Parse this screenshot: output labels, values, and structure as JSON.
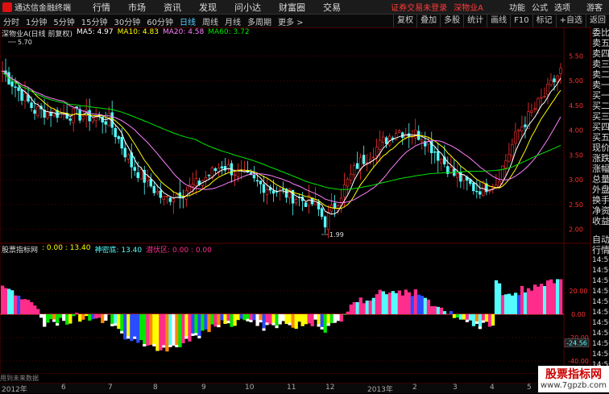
{
  "app": {
    "name": "通达信金融终端",
    "menu": [
      "行情",
      "市场",
      "资讯",
      "发现",
      "问小达",
      "财富圈",
      "交易"
    ],
    "login_warning": "证券交易未登录",
    "stock_title": "深物业A",
    "right_menu": [
      "功能",
      "公式",
      "选项",
      "游客"
    ]
  },
  "tabs": [
    "分时",
    "1分钟",
    "5分钟",
    "15分钟",
    "30分钟",
    "60分钟",
    "日线",
    "周线",
    "月线",
    "多周期",
    "更多 >"
  ],
  "active_tab": "日线",
  "toolbar_right": [
    "复权",
    "叠加",
    "多股",
    "统计",
    "画线",
    "F10",
    "标记",
    "+自选",
    "返回"
  ],
  "main_legend": {
    "title": "深物业A(日线 前复权)",
    "ma5": "MA5: 4.97",
    "ma10": "MA10: 4.83",
    "ma20": "MA20: 4.58",
    "ma60": "MA60: 3.72"
  },
  "price_axis": [
    "5.50",
    "5.00",
    "4.50",
    "4.00",
    "3.50",
    "3.00",
    "2.50",
    "2.00"
  ],
  "annotations": {
    "high": "5.70",
    "low": "1.99"
  },
  "ind_legend": {
    "title": "股票指标网",
    "v1": ": 0.00 : 13.40",
    "v2": "神密底: 13.40",
    "v3": "潜伏区: 0.00 : 0.00"
  },
  "ind_axis": [
    "20.00",
    "0.00",
    "-20.00",
    "-40.00"
  ],
  "ind_marker": "-24.56",
  "side_labels": [
    "委比",
    "卖五",
    "卖四",
    "卖三",
    "卖二",
    "卖一",
    "买一",
    "买二",
    "买三",
    "买四",
    "买五",
    "现价",
    "涨跌",
    "涨幅",
    "总量",
    "外盘",
    "换手",
    "净资",
    "收益"
  ],
  "side_bottom": [
    "自动",
    "行情",
    "14:50",
    "14:50",
    "14:50",
    "14:50",
    "14:50",
    "14:50",
    "14:50",
    "14:50",
    "14:50",
    "14:50",
    "14:50"
  ],
  "status_text": "用到未来数据",
  "month_labels": [
    "2012年",
    "6",
    "7",
    "8",
    "9",
    "10",
    "11",
    "12",
    "2013年",
    "2",
    "3",
    "4",
    "5"
  ],
  "watermark": {
    "title": "股票指标网",
    "url": "www.7gpzb.com"
  },
  "colors": {
    "up": "#ff3232",
    "down": "#54fcfc",
    "ma5": "#ffffff",
    "ma10": "#ffff00",
    "ma20": "#ff80ff",
    "ma60": "#00e600",
    "grid": "#5a0000",
    "bar_pos": "#ff2d8c"
  }
}
